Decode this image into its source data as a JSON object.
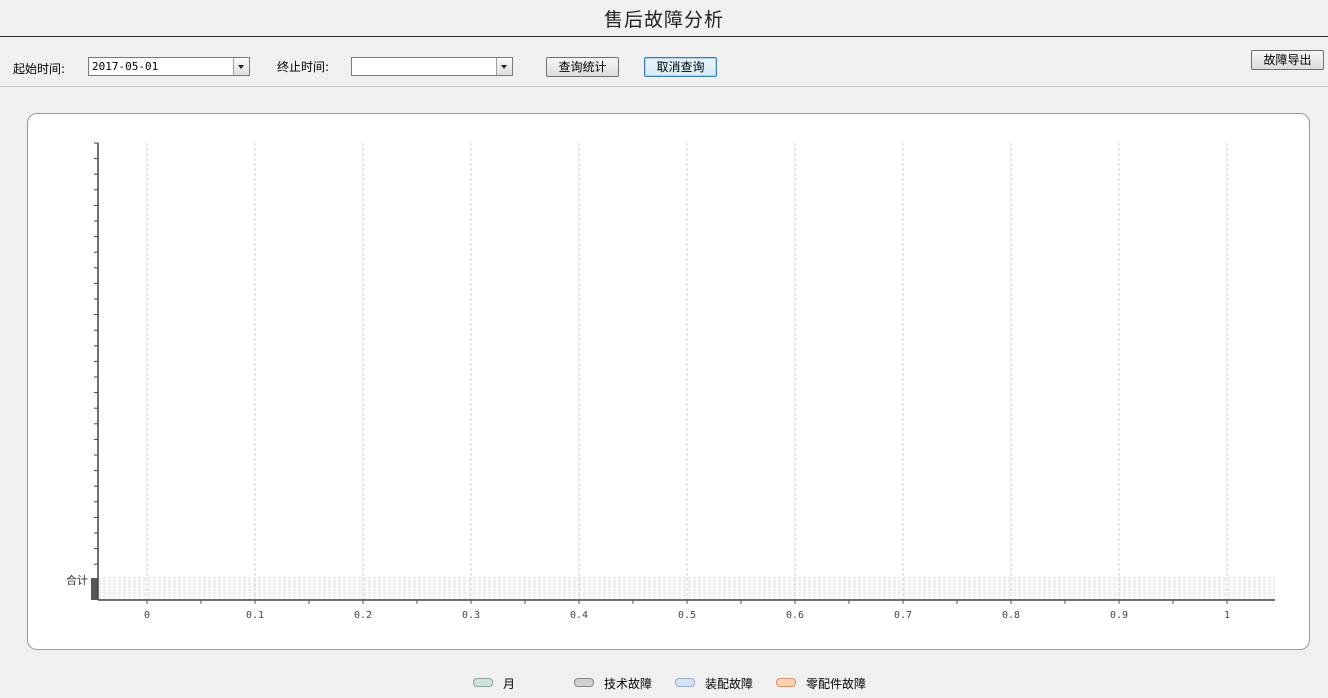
{
  "header": {
    "title": "售后故障分析"
  },
  "toolbar": {
    "start_label": "起始时间:",
    "start_value": "2017-05-01",
    "end_label": "终止时间:",
    "end_value": "",
    "query_button": "查询统计",
    "cancel_button": "取消查询",
    "export_button": "故障导出"
  },
  "chart_data": {
    "type": "bar",
    "orientation": "horizontal",
    "x_ticks": [
      "0",
      "0.1",
      "0.2",
      "0.3",
      "0.4",
      "0.5",
      "0.6",
      "0.7",
      "0.8",
      "0.9",
      "1"
    ],
    "xlim": [
      0,
      1
    ],
    "y_category_label": "合计",
    "grid": true,
    "legend_position": "bottom",
    "series": [
      {
        "name": "月",
        "color": "#cfe3dc",
        "values": []
      },
      {
        "name": "技术故障",
        "color": "#cfcfcf",
        "values": []
      },
      {
        "name": "装配故障",
        "color": "#d4e3f3",
        "values": []
      },
      {
        "name": "零配件故障",
        "color": "#f7d2b8",
        "values": []
      }
    ]
  }
}
